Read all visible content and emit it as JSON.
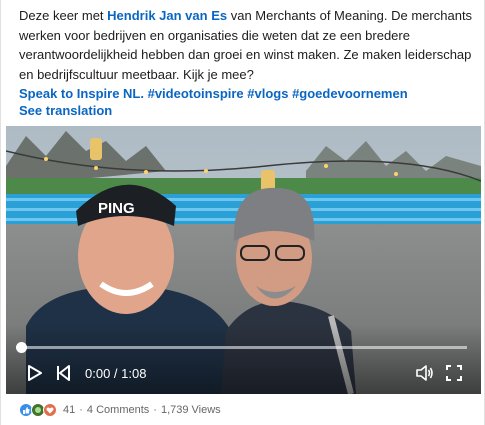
{
  "post": {
    "text_intro": "Deze keer met ",
    "mention": "Hendrik Jan van Es",
    "text_body": " van Merchants of Meaning. De merchants werken voor bedrijven en organisaties die weten dat ze een bredere verantwoordelijkheid hebben dan groei en winst maken. Ze maken leiderschap en bedrijfscultuur meetbaar. Kijk je mee?",
    "hashtags": "Speak to Inspire NL. #videotoinspire #vlogs #goedevoornemen",
    "see_translation": "See translation"
  },
  "video": {
    "current_time": "0:00",
    "separator": " / ",
    "duration": "1:08",
    "progress_fraction": 0.0,
    "cap_text": "PING"
  },
  "footer": {
    "reactions_count": "41",
    "dot1": "·",
    "comments": "4 Comments",
    "dot2": "·",
    "views": "1,739 Views"
  },
  "colors": {
    "link": "#0a66c2",
    "like": "#378fe9",
    "celebrate": "#44712e",
    "love": "#df704d"
  }
}
